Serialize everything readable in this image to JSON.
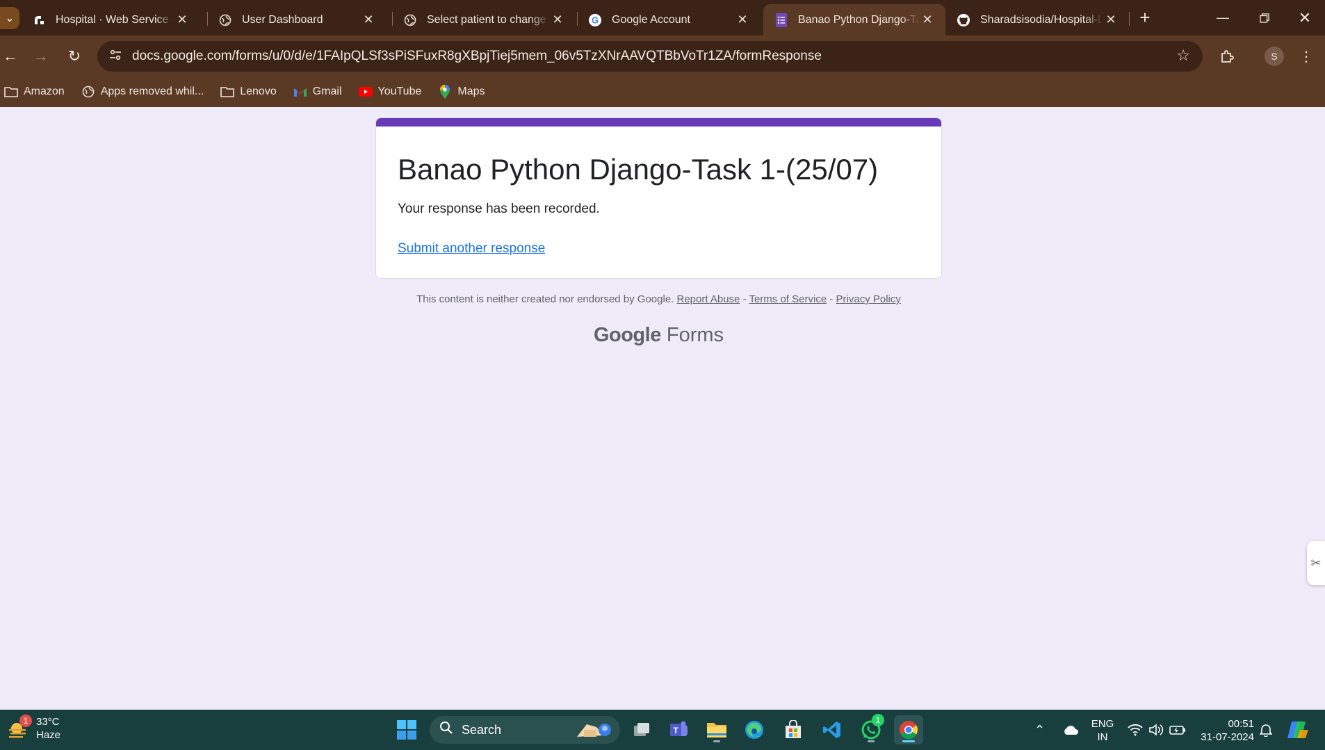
{
  "browser": {
    "tabs": [
      {
        "title": "Hospital · Web Service · ",
        "icon": "render-logo-icon",
        "active": false
      },
      {
        "title": "User Dashboard",
        "icon": "globe-icon",
        "active": false
      },
      {
        "title": "Select patient to change | ",
        "icon": "globe-icon",
        "active": false
      },
      {
        "title": "Google Account",
        "icon": "google-g-icon",
        "active": false
      },
      {
        "title": "Banao Python Django-Task",
        "icon": "google-forms-icon",
        "active": true
      },
      {
        "title": "Sharadsisodia/Hospital-Lo",
        "icon": "github-icon",
        "active": false
      }
    ],
    "url": "docs.google.com/forms/u/0/d/e/1FAIpQLSf3sPiSFuxR8gXBpjTiej5mem_06v5TzXNrAAVQTBbVoTr1ZA/formResponse",
    "profile_initial": "S",
    "bookmarks": [
      {
        "label": "Amazon",
        "icon": "folder-icon"
      },
      {
        "label": "Apps removed whil...",
        "icon": "globe-icon"
      },
      {
        "label": "Lenovo",
        "icon": "folder-icon"
      },
      {
        "label": "Gmail",
        "icon": "gmail-icon"
      },
      {
        "label": "YouTube",
        "icon": "youtube-icon"
      },
      {
        "label": "Maps",
        "icon": "maps-icon"
      }
    ]
  },
  "form": {
    "title": "Banao Python Django-Task 1-(25/07)",
    "message": "Your response has been recorded.",
    "submit_another": "Submit another response",
    "accent_color": "#673ab7"
  },
  "footer": {
    "disclaimer": "This content is neither created nor endorsed by Google.",
    "report_abuse": "Report Abuse",
    "sep1": " - ",
    "terms": "Terms of Service",
    "sep2": " - ",
    "privacy": "Privacy Policy",
    "brand_google": "Google",
    "brand_forms": "Forms"
  },
  "taskbar": {
    "weather_temp": "33°C",
    "weather_desc": "Haze",
    "weather_badge": "1",
    "search_label": "Search",
    "whatsapp_badge": "1",
    "lang_top": "ENG",
    "lang_bottom": "IN",
    "time": "00:51",
    "date": "31-07-2024"
  }
}
